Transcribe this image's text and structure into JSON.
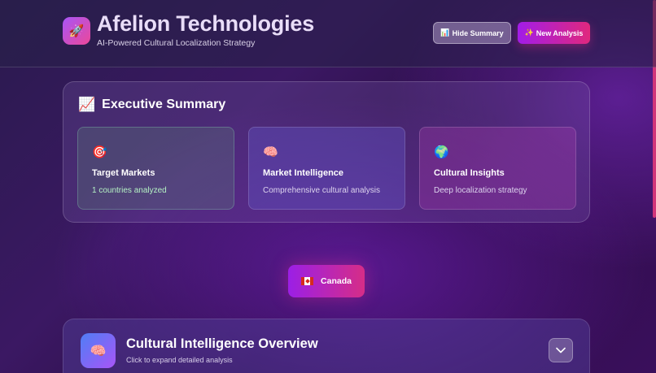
{
  "header": {
    "logo_icon": "🚀",
    "title": "Afelion Technologies",
    "subtitle": "AI-Powered Cultural Localization Strategy",
    "hide_summary_icon": "📊",
    "hide_summary_label": "Hide Summary",
    "new_analysis_icon": "✨",
    "new_analysis_label": "New Analysis"
  },
  "summary": {
    "icon": "📈",
    "title": "Executive Summary",
    "cards": [
      {
        "icon": "🎯",
        "title": "Target Markets",
        "subtitle": "1 countries analyzed"
      },
      {
        "icon": "🧠",
        "title": "Market Intelligence",
        "subtitle": "Comprehensive cultural analysis"
      },
      {
        "icon": "🌍",
        "title": "Cultural Insights",
        "subtitle": "Deep localization strategy"
      }
    ]
  },
  "country": {
    "flag_icon": "canada-flag-icon",
    "label": "Canada"
  },
  "overview": {
    "icon": "🧠",
    "title": "Cultural Intelligence Overview",
    "subtitle": "Click to expand detailed analysis",
    "toggle_icon": "chevron-down-icon"
  },
  "colors": {
    "accent_purple": "#a21ce8",
    "accent_pink": "#e0287d"
  }
}
